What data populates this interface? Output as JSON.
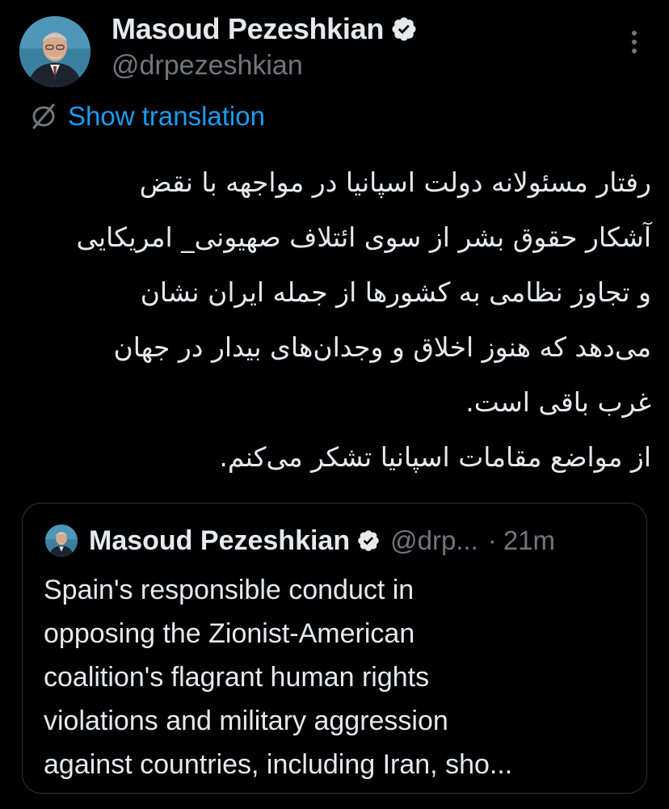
{
  "colors": {
    "background": "#000000",
    "text_primary": "#e7e9ea",
    "text_secondary": "#71767b",
    "link_blue": "#1d9bf0",
    "card_border": "#2f3336",
    "verified_badge": "#e7e9ea"
  },
  "author": {
    "display_name": "Masoud Pezeshkian",
    "handle": "@drpezeshkian",
    "verified": true,
    "avatar_icon": "profile-photo-avatar"
  },
  "more_menu": {
    "icon": "vertical-ellipsis-icon"
  },
  "translation": {
    "icon": "translate-icon",
    "label": "Show translation"
  },
  "tweet": {
    "lines": [
      "رفتار مسئولانه دولت اسپانیا در مواجهه با نقض",
      "آشکار حقوق بشر از سوی ائتلاف صهیونی_ امریکایی",
      "و تجاوز نظامی به کشورها از جمله ایران نشان",
      "می‌دهد که هنوز اخلاق و وجدان‌های بیدار در جهان",
      "غرب باقی است.",
      "از مواضع مقامات اسپانیا تشکر می‌کنم."
    ]
  },
  "quote": {
    "display_name": "Masoud Pezeshkian",
    "handle": "@drp...",
    "separator": "·",
    "time": "21m",
    "verified": true,
    "body_lines": [
      "Spain's responsible conduct in",
      "opposing the Zionist-American",
      "coalition's flagrant human rights",
      "violations and military aggression",
      "against countries, including Iran, sho..."
    ]
  }
}
